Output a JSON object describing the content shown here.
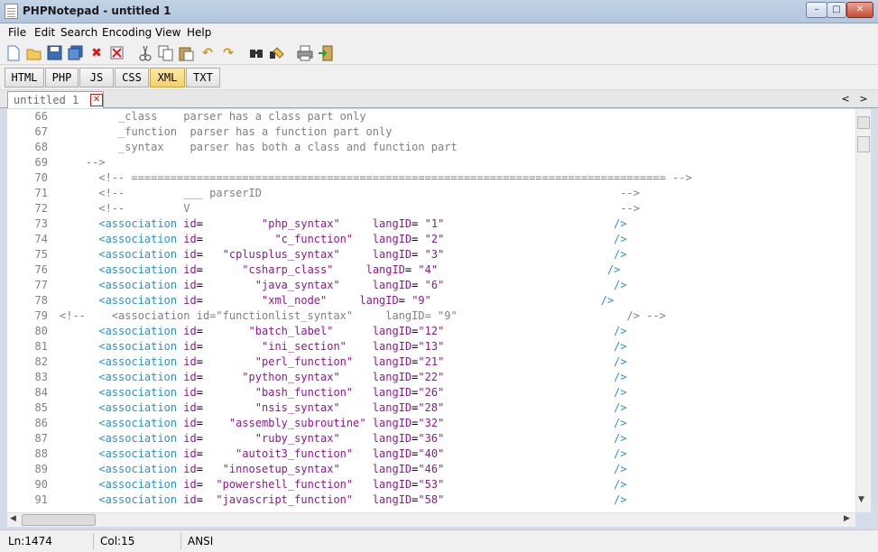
{
  "window": {
    "title": "PHPNotepad - untitled 1",
    "min": "–",
    "max": "□",
    "close": "✕"
  },
  "menu": [
    "File",
    "Edit",
    "Search",
    "Encoding",
    "View",
    "Help"
  ],
  "toolbar_icons": [
    "new-file-icon",
    "open-file-icon",
    "save-icon",
    "save-all-icon",
    "close-icon",
    "close-all-icon",
    "cut-icon",
    "copy-icon",
    "paste-icon",
    "undo-icon",
    "redo-icon",
    "find-icon",
    "replace-icon",
    "print-icon",
    "exit-icon"
  ],
  "languages": {
    "items": [
      "HTML",
      "PHP",
      "JS",
      "CSS",
      "XML",
      "TXT"
    ],
    "active": "XML"
  },
  "tab": {
    "label": "untitled 1",
    "close": "✕",
    "scroll_left": "<",
    "scroll_right": ">"
  },
  "editor": {
    "lines": [
      {
        "n": "66",
        "segs": [
          [
            "c",
            "         _class    parser has a class part only"
          ]
        ]
      },
      {
        "n": "67",
        "segs": [
          [
            "c",
            "         _function  parser has a function part only"
          ]
        ]
      },
      {
        "n": "68",
        "segs": [
          [
            "c",
            "         _syntax    parser has both a class and function part"
          ]
        ]
      },
      {
        "n": "69",
        "segs": [
          [
            "c",
            "    -->"
          ]
        ]
      },
      {
        "n": "70",
        "segs": [
          [
            "c",
            "      <!-- ================================================================================== -->"
          ]
        ]
      },
      {
        "n": "71",
        "segs": [
          [
            "c",
            "      <!--         ___ parserID                                                       -->"
          ]
        ]
      },
      {
        "n": "72",
        "segs": [
          [
            "c",
            "      <!--         V                                                                  -->"
          ]
        ]
      },
      {
        "n": "73",
        "segs": [
          [
            "t",
            "      <association"
          ],
          [
            "a",
            " id"
          ],
          [
            "p",
            "="
          ],
          [
            "v",
            "         \"php_syntax\""
          ],
          [
            "a",
            "     langID"
          ],
          [
            "p",
            "= "
          ],
          [
            "v",
            "\"1\""
          ],
          [
            "t",
            "                          />"
          ]
        ]
      },
      {
        "n": "74",
        "segs": [
          [
            "t",
            "      <association"
          ],
          [
            "a",
            " id"
          ],
          [
            "p",
            "="
          ],
          [
            "v",
            "           \"c_function\""
          ],
          [
            "a",
            "   langID"
          ],
          [
            "p",
            "= "
          ],
          [
            "v",
            "\"2\""
          ],
          [
            "t",
            "                          />"
          ]
        ]
      },
      {
        "n": "75",
        "segs": [
          [
            "t",
            "      <association"
          ],
          [
            "a",
            " id"
          ],
          [
            "p",
            "="
          ],
          [
            "v",
            "   \"cplusplus_syntax\""
          ],
          [
            "a",
            "     langID"
          ],
          [
            "p",
            "= "
          ],
          [
            "v",
            "\"3\""
          ],
          [
            "t",
            "                          />"
          ]
        ]
      },
      {
        "n": "76",
        "segs": [
          [
            "t",
            "      <association"
          ],
          [
            "a",
            " id"
          ],
          [
            "p",
            "="
          ],
          [
            "v",
            "      \"csharp_class\""
          ],
          [
            "a",
            "     langID"
          ],
          [
            "p",
            "= "
          ],
          [
            "v",
            "\"4\""
          ],
          [
            "t",
            "                          />"
          ]
        ]
      },
      {
        "n": "77",
        "segs": [
          [
            "t",
            "      <association"
          ],
          [
            "a",
            " id"
          ],
          [
            "p",
            "="
          ],
          [
            "v",
            "        \"java_syntax\""
          ],
          [
            "a",
            "     langID"
          ],
          [
            "p",
            "= "
          ],
          [
            "v",
            "\"6\""
          ],
          [
            "t",
            "                          />"
          ]
        ]
      },
      {
        "n": "78",
        "segs": [
          [
            "t",
            "      <association"
          ],
          [
            "a",
            " id"
          ],
          [
            "p",
            "="
          ],
          [
            "v",
            "         \"xml_node\""
          ],
          [
            "a",
            "     langID"
          ],
          [
            "p",
            "= "
          ],
          [
            "v",
            "\"9\""
          ],
          [
            "t",
            "                          />"
          ]
        ]
      },
      {
        "n": "79",
        "segs": [
          [
            "c",
            "<!--    <association id=\"functionlist_syntax\"     langID= \"9\"                          /> -->"
          ]
        ]
      },
      {
        "n": "80",
        "segs": [
          [
            "t",
            "      <association"
          ],
          [
            "a",
            " id"
          ],
          [
            "p",
            "="
          ],
          [
            "v",
            "       \"batch_label\""
          ],
          [
            "a",
            "      langID"
          ],
          [
            "p",
            "="
          ],
          [
            "v",
            "\"12\""
          ],
          [
            "t",
            "                          />"
          ]
        ]
      },
      {
        "n": "81",
        "segs": [
          [
            "t",
            "      <association"
          ],
          [
            "a",
            " id"
          ],
          [
            "p",
            "="
          ],
          [
            "v",
            "         \"ini_section\""
          ],
          [
            "a",
            "    langID"
          ],
          [
            "p",
            "="
          ],
          [
            "v",
            "\"13\""
          ],
          [
            "t",
            "                          />"
          ]
        ]
      },
      {
        "n": "82",
        "segs": [
          [
            "t",
            "      <association"
          ],
          [
            "a",
            " id"
          ],
          [
            "p",
            "="
          ],
          [
            "v",
            "        \"perl_function\""
          ],
          [
            "a",
            "   langID"
          ],
          [
            "p",
            "="
          ],
          [
            "v",
            "\"21\""
          ],
          [
            "t",
            "                          />"
          ]
        ]
      },
      {
        "n": "83",
        "segs": [
          [
            "t",
            "      <association"
          ],
          [
            "a",
            " id"
          ],
          [
            "p",
            "="
          ],
          [
            "v",
            "      \"python_syntax\""
          ],
          [
            "a",
            "     langID"
          ],
          [
            "p",
            "="
          ],
          [
            "v",
            "\"22\""
          ],
          [
            "t",
            "                          />"
          ]
        ]
      },
      {
        "n": "84",
        "segs": [
          [
            "t",
            "      <association"
          ],
          [
            "a",
            " id"
          ],
          [
            "p",
            "="
          ],
          [
            "v",
            "        \"bash_function\""
          ],
          [
            "a",
            "   langID"
          ],
          [
            "p",
            "="
          ],
          [
            "v",
            "\"26\""
          ],
          [
            "t",
            "                          />"
          ]
        ]
      },
      {
        "n": "85",
        "segs": [
          [
            "t",
            "      <association"
          ],
          [
            "a",
            " id"
          ],
          [
            "p",
            "="
          ],
          [
            "v",
            "        \"nsis_syntax\""
          ],
          [
            "a",
            "     langID"
          ],
          [
            "p",
            "="
          ],
          [
            "v",
            "\"28\""
          ],
          [
            "t",
            "                          />"
          ]
        ]
      },
      {
        "n": "86",
        "segs": [
          [
            "t",
            "      <association"
          ],
          [
            "a",
            " id"
          ],
          [
            "p",
            "="
          ],
          [
            "v",
            "    \"assembly_subroutine\""
          ],
          [
            "a",
            " langID"
          ],
          [
            "p",
            "="
          ],
          [
            "v",
            "\"32\""
          ],
          [
            "t",
            "                          />"
          ]
        ]
      },
      {
        "n": "87",
        "segs": [
          [
            "t",
            "      <association"
          ],
          [
            "a",
            " id"
          ],
          [
            "p",
            "="
          ],
          [
            "v",
            "        \"ruby_syntax\""
          ],
          [
            "a",
            "     langID"
          ],
          [
            "p",
            "="
          ],
          [
            "v",
            "\"36\""
          ],
          [
            "t",
            "                          />"
          ]
        ]
      },
      {
        "n": "88",
        "segs": [
          [
            "t",
            "      <association"
          ],
          [
            "a",
            " id"
          ],
          [
            "p",
            "="
          ],
          [
            "v",
            "     \"autoit3_function\""
          ],
          [
            "a",
            "   langID"
          ],
          [
            "p",
            "="
          ],
          [
            "v",
            "\"40\""
          ],
          [
            "t",
            "                          />"
          ]
        ]
      },
      {
        "n": "89",
        "segs": [
          [
            "t",
            "      <association"
          ],
          [
            "a",
            " id"
          ],
          [
            "p",
            "="
          ],
          [
            "v",
            "   \"innosetup_syntax\""
          ],
          [
            "a",
            "     langID"
          ],
          [
            "p",
            "="
          ],
          [
            "v",
            "\"46\""
          ],
          [
            "t",
            "                          />"
          ]
        ]
      },
      {
        "n": "90",
        "segs": [
          [
            "t",
            "      <association"
          ],
          [
            "a",
            " id"
          ],
          [
            "p",
            "="
          ],
          [
            "v",
            "  \"powershell_function\""
          ],
          [
            "a",
            "   langID"
          ],
          [
            "p",
            "="
          ],
          [
            "v",
            "\"53\""
          ],
          [
            "t",
            "                          />"
          ]
        ]
      },
      {
        "n": "91",
        "segs": [
          [
            "t",
            "      <association"
          ],
          [
            "a",
            " id"
          ],
          [
            "p",
            "="
          ],
          [
            "v",
            "  \"javascript_function\""
          ],
          [
            "a",
            "   langID"
          ],
          [
            "p",
            "="
          ],
          [
            "v",
            "\"58\""
          ],
          [
            "t",
            "                          />"
          ]
        ]
      }
    ]
  },
  "status": {
    "line": "Ln:1474",
    "col": "Col:15",
    "encoding": "ANSI"
  },
  "colors": {
    "tag": "#2d8fcf",
    "attr": "#8a1a8a",
    "comment": "#7f7f7f",
    "active_lang": "#f4d16f"
  }
}
